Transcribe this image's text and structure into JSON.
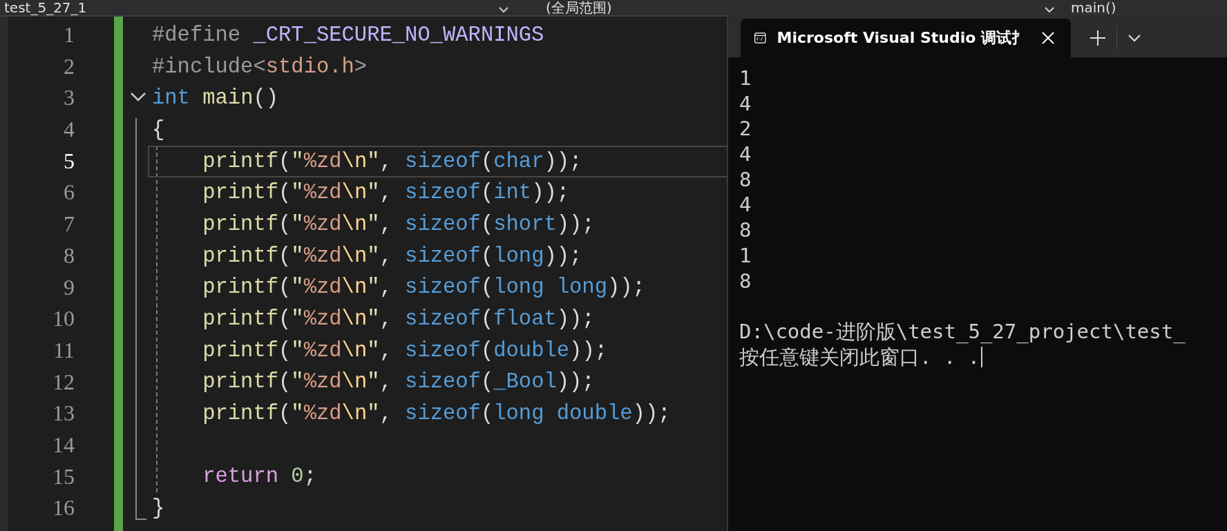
{
  "top_bar": {
    "project": "test_5_27_1",
    "scope": "(全局范围)",
    "member": "main()"
  },
  "editor": {
    "lines": [
      {
        "number": "1",
        "current": false,
        "tokens": [
          {
            "kind": "pre",
            "text": "#define "
          },
          {
            "kind": "macro",
            "text": "_CRT_SECURE_NO_WARNINGS"
          }
        ]
      },
      {
        "number": "2",
        "current": false,
        "tokens": [
          {
            "kind": "pre",
            "text": "#include<"
          },
          {
            "kind": "str",
            "text": "stdio.h"
          },
          {
            "kind": "pre",
            "text": ">"
          }
        ]
      },
      {
        "number": "3",
        "current": false,
        "fold": true,
        "tokens": [
          {
            "kind": "kw",
            "text": "int"
          },
          {
            "kind": "fn",
            "text": " main"
          },
          {
            "kind": "punct",
            "text": "()"
          }
        ]
      },
      {
        "number": "4",
        "current": false,
        "tokens": [
          {
            "kind": "punct",
            "text": "{"
          }
        ]
      },
      {
        "number": "5",
        "current": true,
        "tokens": [
          {
            "kind": "fn",
            "text": "    printf"
          },
          {
            "kind": "punct",
            "text": "("
          },
          {
            "kind": "q",
            "text": "\""
          },
          {
            "kind": "str",
            "text": "%zd"
          },
          {
            "kind": "esc",
            "text": "\\n"
          },
          {
            "kind": "q",
            "text": "\""
          },
          {
            "kind": "punct",
            "text": ", "
          },
          {
            "kind": "kw",
            "text": "sizeof"
          },
          {
            "kind": "punct",
            "text": "("
          },
          {
            "kind": "kw",
            "text": "char"
          },
          {
            "kind": "punct",
            "text": "));"
          }
        ]
      },
      {
        "number": "6",
        "current": false,
        "tokens": [
          {
            "kind": "fn",
            "text": "    printf"
          },
          {
            "kind": "punct",
            "text": "("
          },
          {
            "kind": "q",
            "text": "\""
          },
          {
            "kind": "str",
            "text": "%zd"
          },
          {
            "kind": "esc",
            "text": "\\n"
          },
          {
            "kind": "q",
            "text": "\""
          },
          {
            "kind": "punct",
            "text": ", "
          },
          {
            "kind": "kw",
            "text": "sizeof"
          },
          {
            "kind": "punct",
            "text": "("
          },
          {
            "kind": "kw",
            "text": "int"
          },
          {
            "kind": "punct",
            "text": "));"
          }
        ]
      },
      {
        "number": "7",
        "current": false,
        "tokens": [
          {
            "kind": "fn",
            "text": "    printf"
          },
          {
            "kind": "punct",
            "text": "("
          },
          {
            "kind": "q",
            "text": "\""
          },
          {
            "kind": "str",
            "text": "%zd"
          },
          {
            "kind": "esc",
            "text": "\\n"
          },
          {
            "kind": "q",
            "text": "\""
          },
          {
            "kind": "punct",
            "text": ", "
          },
          {
            "kind": "kw",
            "text": "sizeof"
          },
          {
            "kind": "punct",
            "text": "("
          },
          {
            "kind": "kw",
            "text": "short"
          },
          {
            "kind": "punct",
            "text": "));"
          }
        ]
      },
      {
        "number": "8",
        "current": false,
        "tokens": [
          {
            "kind": "fn",
            "text": "    printf"
          },
          {
            "kind": "punct",
            "text": "("
          },
          {
            "kind": "q",
            "text": "\""
          },
          {
            "kind": "str",
            "text": "%zd"
          },
          {
            "kind": "esc",
            "text": "\\n"
          },
          {
            "kind": "q",
            "text": "\""
          },
          {
            "kind": "punct",
            "text": ", "
          },
          {
            "kind": "kw",
            "text": "sizeof"
          },
          {
            "kind": "punct",
            "text": "("
          },
          {
            "kind": "kw",
            "text": "long"
          },
          {
            "kind": "punct",
            "text": "));"
          }
        ]
      },
      {
        "number": "9",
        "current": false,
        "tokens": [
          {
            "kind": "fn",
            "text": "    printf"
          },
          {
            "kind": "punct",
            "text": "("
          },
          {
            "kind": "q",
            "text": "\""
          },
          {
            "kind": "str",
            "text": "%zd"
          },
          {
            "kind": "esc",
            "text": "\\n"
          },
          {
            "kind": "q",
            "text": "\""
          },
          {
            "kind": "punct",
            "text": ", "
          },
          {
            "kind": "kw",
            "text": "sizeof"
          },
          {
            "kind": "punct",
            "text": "("
          },
          {
            "kind": "kw",
            "text": "long long"
          },
          {
            "kind": "punct",
            "text": "));"
          }
        ]
      },
      {
        "number": "10",
        "current": false,
        "tokens": [
          {
            "kind": "fn",
            "text": "    printf"
          },
          {
            "kind": "punct",
            "text": "("
          },
          {
            "kind": "q",
            "text": "\""
          },
          {
            "kind": "str",
            "text": "%zd"
          },
          {
            "kind": "esc",
            "text": "\\n"
          },
          {
            "kind": "q",
            "text": "\""
          },
          {
            "kind": "punct",
            "text": ", "
          },
          {
            "kind": "kw",
            "text": "sizeof"
          },
          {
            "kind": "punct",
            "text": "("
          },
          {
            "kind": "kw",
            "text": "float"
          },
          {
            "kind": "punct",
            "text": "));"
          }
        ]
      },
      {
        "number": "11",
        "current": false,
        "tokens": [
          {
            "kind": "fn",
            "text": "    printf"
          },
          {
            "kind": "punct",
            "text": "("
          },
          {
            "kind": "q",
            "text": "\""
          },
          {
            "kind": "str",
            "text": "%zd"
          },
          {
            "kind": "esc",
            "text": "\\n"
          },
          {
            "kind": "q",
            "text": "\""
          },
          {
            "kind": "punct",
            "text": ", "
          },
          {
            "kind": "kw",
            "text": "sizeof"
          },
          {
            "kind": "punct",
            "text": "("
          },
          {
            "kind": "kw",
            "text": "double"
          },
          {
            "kind": "punct",
            "text": "));"
          }
        ]
      },
      {
        "number": "12",
        "current": false,
        "tokens": [
          {
            "kind": "fn",
            "text": "    printf"
          },
          {
            "kind": "punct",
            "text": "("
          },
          {
            "kind": "q",
            "text": "\""
          },
          {
            "kind": "str",
            "text": "%zd"
          },
          {
            "kind": "esc",
            "text": "\\n"
          },
          {
            "kind": "q",
            "text": "\""
          },
          {
            "kind": "punct",
            "text": ", "
          },
          {
            "kind": "kw",
            "text": "sizeof"
          },
          {
            "kind": "punct",
            "text": "("
          },
          {
            "kind": "kw",
            "text": "_Bool"
          },
          {
            "kind": "punct",
            "text": "));"
          }
        ]
      },
      {
        "number": "13",
        "current": false,
        "tokens": [
          {
            "kind": "fn",
            "text": "    printf"
          },
          {
            "kind": "punct",
            "text": "("
          },
          {
            "kind": "q",
            "text": "\""
          },
          {
            "kind": "str",
            "text": "%zd"
          },
          {
            "kind": "esc",
            "text": "\\n"
          },
          {
            "kind": "q",
            "text": "\""
          },
          {
            "kind": "punct",
            "text": ", "
          },
          {
            "kind": "kw",
            "text": "sizeof"
          },
          {
            "kind": "punct",
            "text": "("
          },
          {
            "kind": "kw",
            "text": "long double"
          },
          {
            "kind": "punct",
            "text": "));"
          }
        ]
      },
      {
        "number": "14",
        "current": false
      },
      {
        "number": "15",
        "current": false,
        "tokens": [
          {
            "kind": "ctl",
            "text": "    return"
          },
          {
            "kind": "num",
            "text": " 0"
          },
          {
            "kind": "punct",
            "text": ";"
          }
        ]
      },
      {
        "number": "16",
        "current": false,
        "tokens": [
          {
            "kind": "punct",
            "text": "}"
          }
        ]
      }
    ]
  },
  "console": {
    "tab_title": "Microsoft Visual Studio 调试扌",
    "output": [
      "1",
      "4",
      "2",
      "4",
      "8",
      "4",
      "8",
      "1",
      "8"
    ],
    "path": "D:\\code-进阶版\\test_5_27_project\\test_",
    "prompt": "按任意键关闭此窗口. . ."
  }
}
